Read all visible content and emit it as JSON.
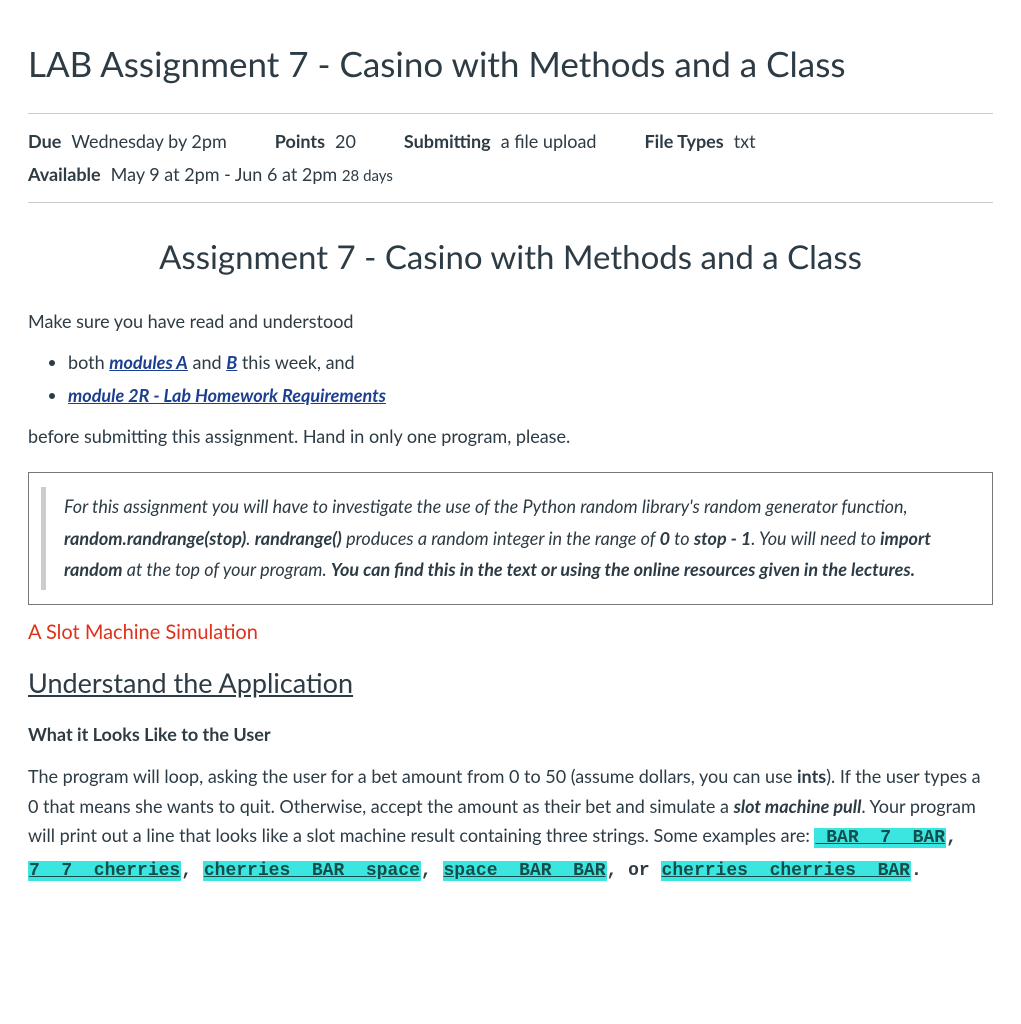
{
  "page_title": "LAB Assignment 7 - Casino with Methods and a Class",
  "meta": {
    "due_label": "Due",
    "due_value": "Wednesday by 2pm",
    "points_label": "Points",
    "points_value": "20",
    "submitting_label": "Submitting",
    "submitting_value": "a file upload",
    "filetypes_label": "File Types",
    "filetypes_value": "txt",
    "available_label": "Available",
    "available_value": "May 9 at 2pm - Jun 6 at 2pm",
    "available_days": "28 days"
  },
  "subtitle": "Assignment 7 - Casino with Methods and a Class",
  "intro_p": "Make sure you have read and understood",
  "bullets": {
    "b1_pre": "both ",
    "b1_link1": "modules A",
    "b1_mid": " and ",
    "b1_link2": "B",
    "b1_post": " this week, and",
    "b2_link": "module 2R - Lab Homework Requirements"
  },
  "after_list": "before submitting this assignment. Hand in only one program, please.",
  "quote": {
    "s1": "For this assignment you will have to investigate the use of the Python random library's random generator function, ",
    "b1": "random.randrange(stop)",
    "s2": ".  ",
    "b2": "randrange()",
    "s3": " produces a random integer in the range of ",
    "b3": "0",
    "s4": " to ",
    "b4": "stop - 1",
    "s5": ".   You will need to ",
    "b5": "import random",
    "s6": " at the top of your program. ",
    "b6": "You can find this in the text or using the online resources given in the lectures."
  },
  "red_heading": "A Slot Machine Simulation",
  "h3": "Understand the Application",
  "h4": "What it Looks Like to the User",
  "para": {
    "p1a": "The program will loop, asking the user for a bet amount from 0 to 50  (assume dollars, you can use ",
    "p1_ints": "ints",
    "p1b": ").  If the user types a 0 that means she wants to quit.  Otherwise, accept the amount as their bet and simulate a ",
    "p1_slot": "slot machine pull",
    "p1c": ".  Your program will print out a line that looks like a slot machine result containing three strings.  Some examples are:",
    "hl1": " BAR  7  BAR",
    "comma1": ", ",
    "hl2": "7  7  cherries",
    "comma2": ", ",
    "hl3": "cherries  BAR  space",
    "comma3": ", ",
    "hl4": "space  BAR  BAR",
    "or": ", or ",
    "hl5": "cherries  cherries  BAR",
    "period": "."
  }
}
